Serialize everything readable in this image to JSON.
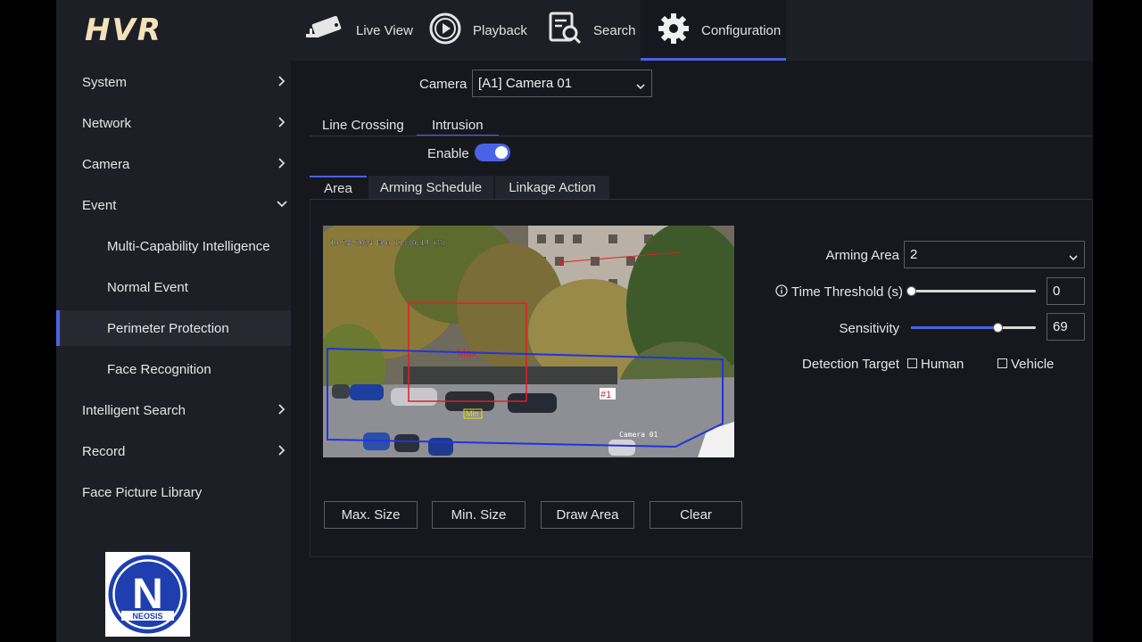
{
  "header": {
    "logo": "HVR",
    "nav": [
      {
        "label": "Live View",
        "icon": "camera-icon"
      },
      {
        "label": "Playback",
        "icon": "playback-icon"
      },
      {
        "label": "Search",
        "icon": "search-icon"
      },
      {
        "label": "Configuration",
        "icon": "gear-icon",
        "active": true
      }
    ]
  },
  "sidebar": {
    "items": [
      {
        "label": "System",
        "expand": "right"
      },
      {
        "label": "Network",
        "expand": "right"
      },
      {
        "label": "Camera",
        "expand": "right"
      },
      {
        "label": "Event",
        "expand": "down"
      },
      {
        "label": "Multi-Capability Intelligence",
        "sub": true
      },
      {
        "label": "Normal Event",
        "sub": true
      },
      {
        "label": "Perimeter Protection",
        "sub": true,
        "active": true
      },
      {
        "label": "Face Recognition",
        "sub": true
      },
      {
        "label": "Intelligent Search",
        "expand": "right"
      },
      {
        "label": "Record",
        "expand": "right"
      },
      {
        "label": "Face Picture Library"
      }
    ],
    "brand_logo": {
      "letter": "N",
      "text": "NEOSIS"
    }
  },
  "content": {
    "camera_label": "Camera",
    "camera_value": "[A1] Camera 01",
    "tabs": [
      "Line Crossing",
      "Intrusion"
    ],
    "active_tab": "Intrusion",
    "enable_label": "Enable",
    "enable_on": true,
    "subtabs": [
      "Area",
      "Arming Schedule",
      "Linkage Action"
    ],
    "active_subtab": "Area",
    "preview": {
      "osd_timestamp": "10-28-2024 Mon 13:30:19 (M)",
      "osd_camera": "Camera 01",
      "labels": {
        "max": "Max",
        "min": "Min",
        "zone": "#1"
      }
    },
    "buttons": [
      "Max. Size",
      "Min. Size",
      "Draw Area",
      "Clear"
    ],
    "settings": {
      "arming_area_label": "Arming Area",
      "arming_area_value": "2",
      "time_threshold_label": "Time Threshold (s)",
      "time_threshold_value": "0",
      "time_threshold_level": 0,
      "sensitivity_label": "Sensitivity",
      "sensitivity_value": "69",
      "sensitivity_level": 0.69,
      "detection_target_label": "Detection Target",
      "targets": [
        {
          "label": "Human",
          "checked": false
        },
        {
          "label": "Vehicle",
          "checked": false
        }
      ]
    }
  },
  "colors": {
    "accent": "#4a63e6",
    "background": "#16181e",
    "panel": "#1d1f26"
  }
}
